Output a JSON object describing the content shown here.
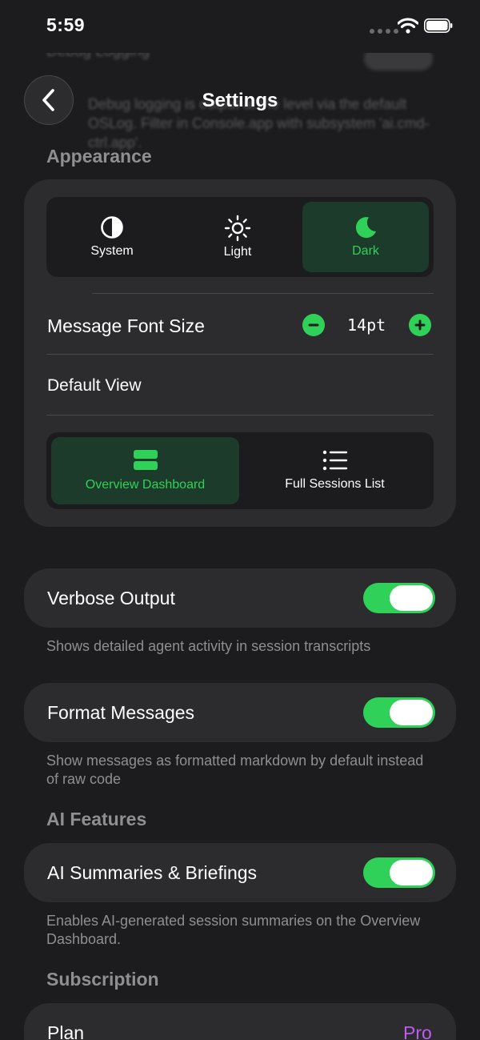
{
  "status_bar": {
    "time": "5:59"
  },
  "nav": {
    "title": "Settings"
  },
  "blurred": {
    "row_label": "Debug Logging",
    "footnote": "Debug logging is output at the level via the default OSLog. Filter in Console.app with subsystem 'ai.cmd-ctrl.app'."
  },
  "appearance": {
    "header": "Appearance",
    "theme_options": [
      {
        "label": "System",
        "icon": "half-circle-icon",
        "selected": false
      },
      {
        "label": "Light",
        "icon": "sun-icon",
        "selected": false
      },
      {
        "label": "Dark",
        "icon": "moon-icon",
        "selected": true
      }
    ],
    "font_size_label": "Message Font Size",
    "font_size_value": "14pt",
    "default_view_label": "Default View",
    "view_options": [
      {
        "label": "Overview Dashboard",
        "icon": "dashboard-icon",
        "selected": true
      },
      {
        "label": "Full Sessions List",
        "icon": "list-icon",
        "selected": false
      }
    ]
  },
  "verbose": {
    "label": "Verbose Output",
    "enabled": true,
    "footnote": "Shows detailed agent activity in session transcripts"
  },
  "format": {
    "label": "Format Messages",
    "enabled": true,
    "footnote": "Show messages as formatted markdown by default instead of raw code"
  },
  "ai_features": {
    "header": "AI Features",
    "label": "AI Summaries & Briefings",
    "enabled": true,
    "footnote": "Enables AI-generated session summaries on the Overview Dashboard."
  },
  "subscription": {
    "header": "Subscription",
    "plan_label": "Plan",
    "plan_value": "Pro"
  },
  "colors": {
    "accent_green": "#30d158",
    "selected_bg": "#1d3b2a",
    "pro_purple": "#bf5af2",
    "card_bg": "#2c2c2e",
    "page_bg": "#1c1c1e",
    "secondary_text": "#8e8e93"
  }
}
